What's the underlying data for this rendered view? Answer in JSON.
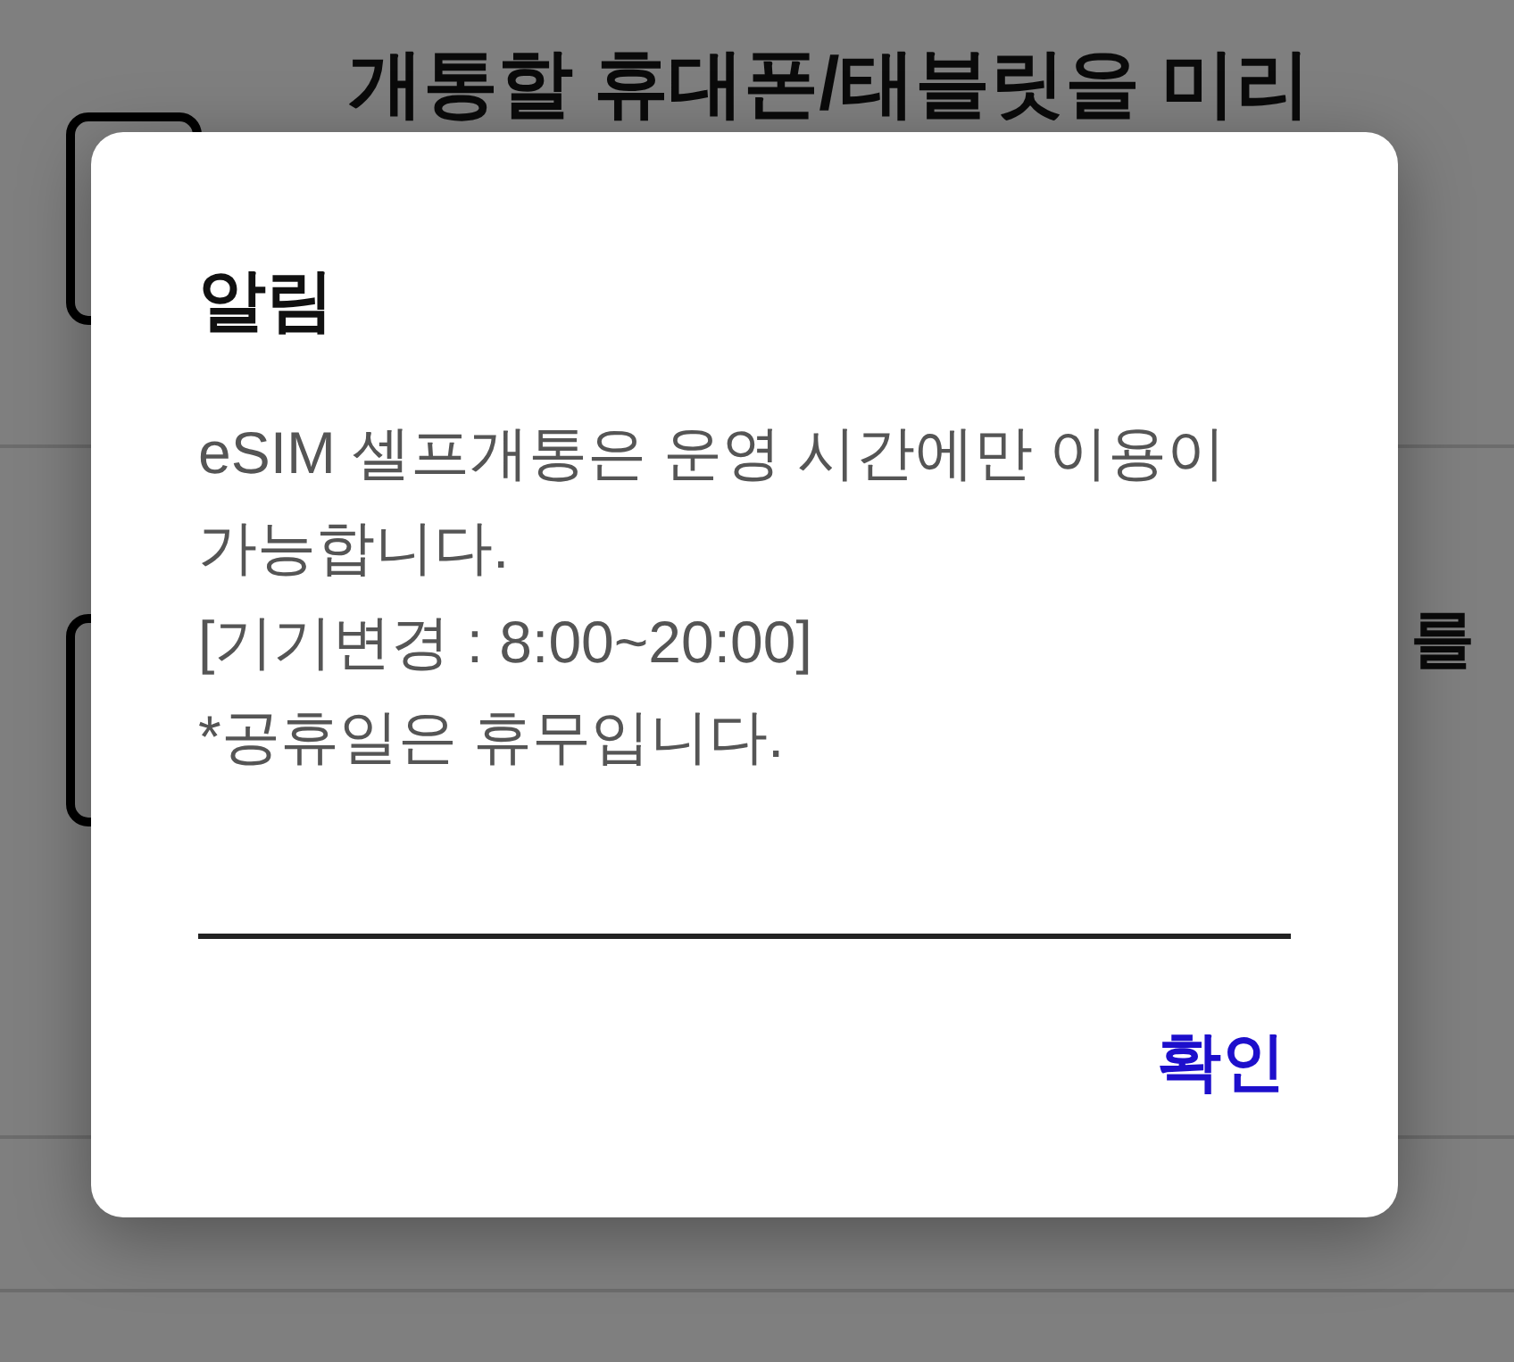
{
  "background": {
    "rows": [
      {
        "text": "개통할 휴대폰/태블릿을 미리"
      },
      {
        "text": "를"
      }
    ]
  },
  "dialog": {
    "title": "알림",
    "message": [
      "eSIM 셀프개통은 운영 시간에만 이용이 가능합니다.",
      "[기기변경 : 8:00~20:00]",
      "*공휴일은 휴무입니다."
    ],
    "buttons": [
      {
        "label": "확인"
      }
    ]
  }
}
